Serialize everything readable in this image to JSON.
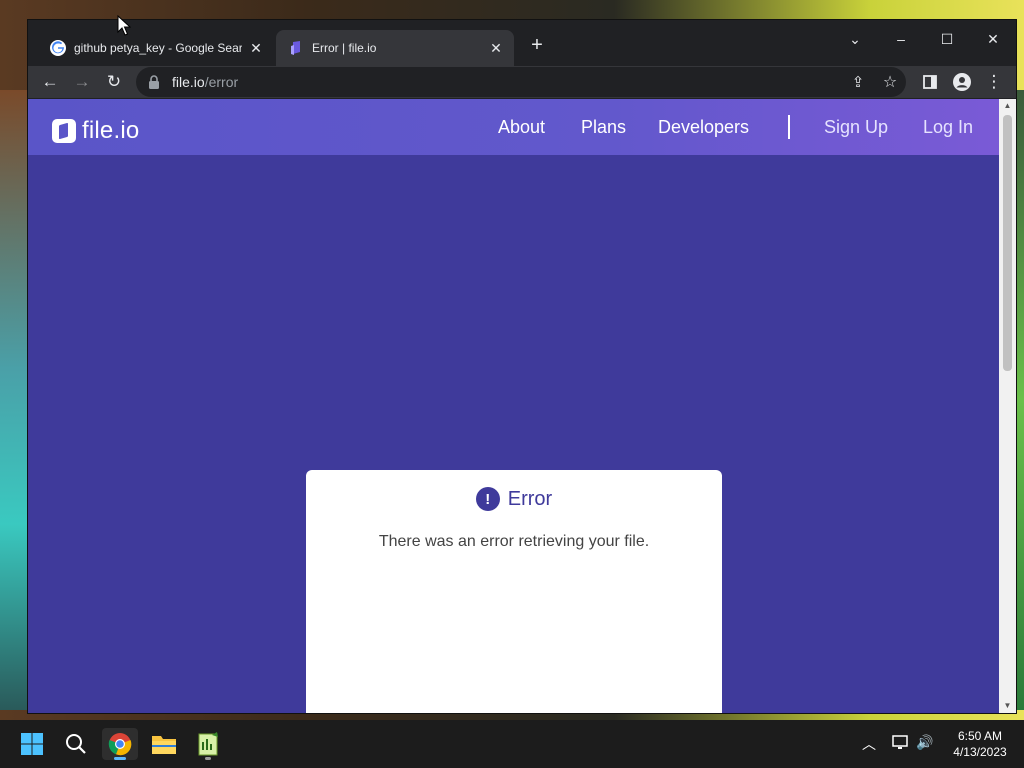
{
  "browser": {
    "tabs": [
      {
        "title": "github petya_key - Google Search",
        "active": false
      },
      {
        "title": "Error | file.io",
        "active": true
      }
    ],
    "url_host": "file.io",
    "url_path": "/error"
  },
  "site": {
    "logo_text": "file.io",
    "nav": {
      "about": "About",
      "plans": "Plans",
      "developers": "Developers",
      "signup": "Sign Up",
      "login": "Log In"
    },
    "error": {
      "title": "Error",
      "message": "There was an error retrieving your file."
    }
  },
  "taskbar": {
    "time": "6:50 AM",
    "date": "4/13/2023"
  },
  "colors": {
    "page_bg": "#3f3a9b",
    "nav_bg": "#5a55c8",
    "accent": "#3f3a9b"
  }
}
